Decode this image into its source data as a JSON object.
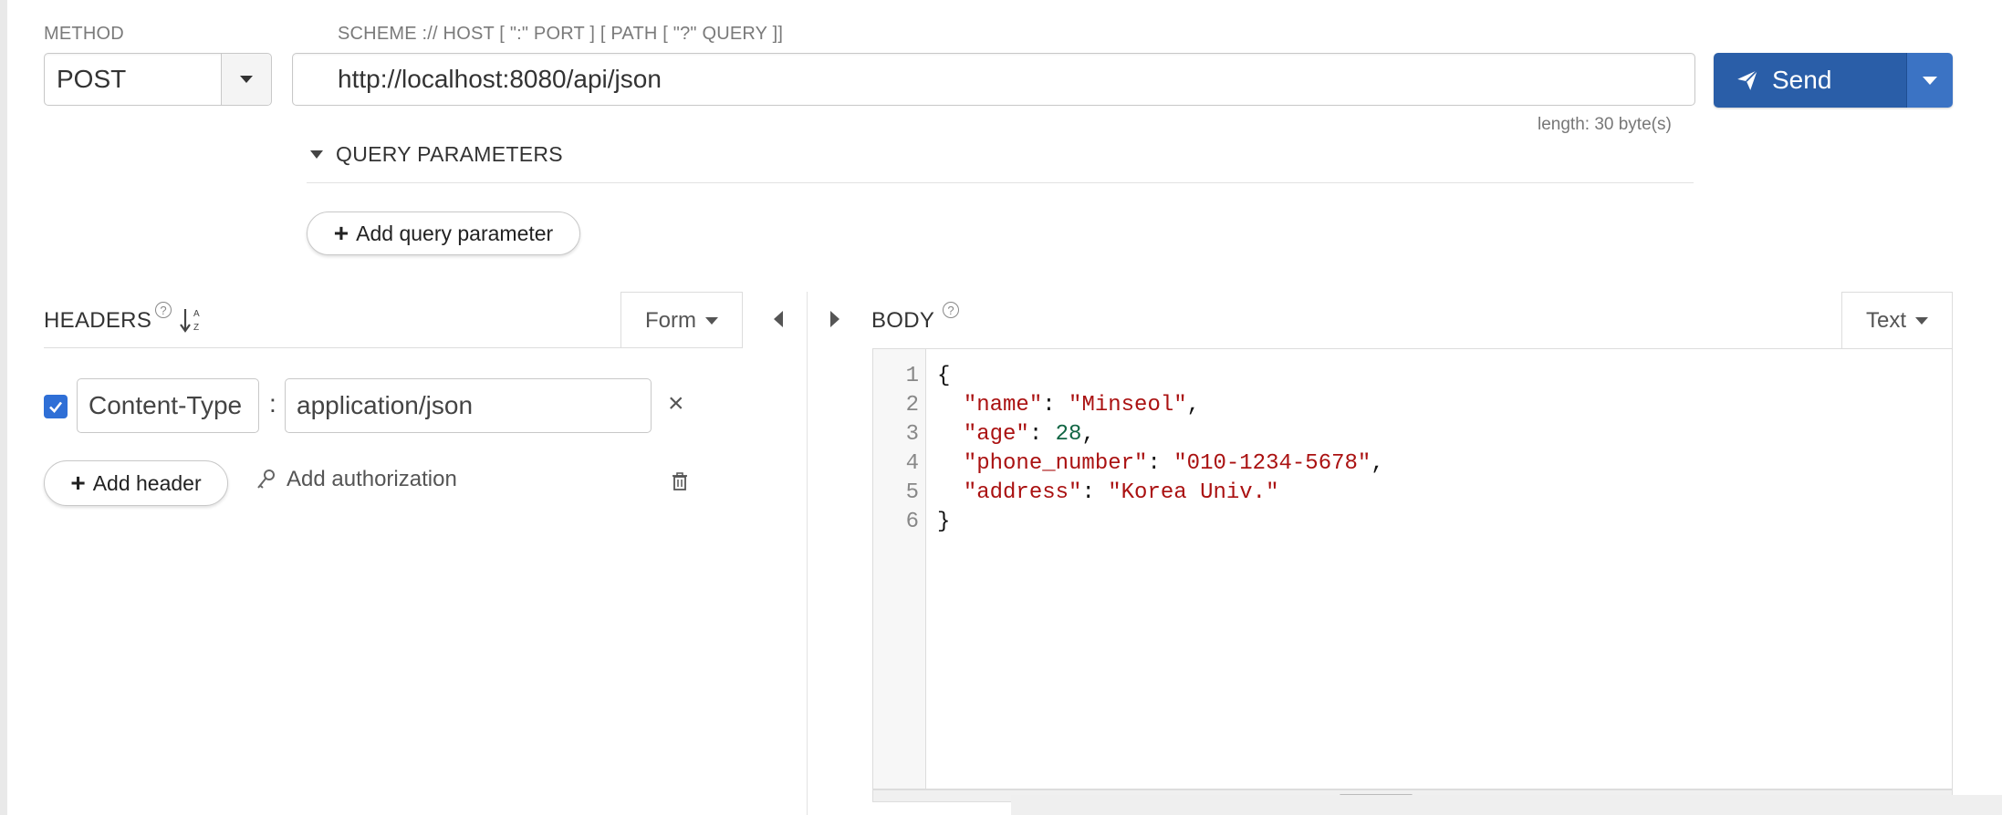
{
  "method": {
    "label": "METHOD",
    "value": "POST"
  },
  "url": {
    "label": "SCHEME :// HOST [ \":\" PORT ] [ PATH [ \"?\" QUERY ]]",
    "value": "http://localhost:8080/api/json",
    "length_text": "length: 30 byte(s)"
  },
  "send": {
    "label": "Send"
  },
  "query_parameters": {
    "title": "QUERY PARAMETERS",
    "add_label": "Add query parameter"
  },
  "headers": {
    "title": "HEADERS",
    "help": "?",
    "mode": "Form",
    "items": [
      {
        "enabled": true,
        "key": "Content-Type",
        "value": "application/json"
      }
    ],
    "separator": ":",
    "add_header_label": "Add header",
    "add_auth_label": "Add authorization"
  },
  "body": {
    "title": "BODY",
    "help": "?",
    "mode": "Text",
    "lines": [
      {
        "n": "1",
        "text": "{"
      },
      {
        "n": "2",
        "key": "\"name\"",
        "value": "\"Minseol\"",
        "type": "string",
        "trail": ","
      },
      {
        "n": "3",
        "key": "\"age\"",
        "value": "28",
        "type": "number",
        "trail": ","
      },
      {
        "n": "4",
        "key": "\"phone_number\"",
        "value": "\"010-1234-5678\"",
        "type": "string",
        "trail": ","
      },
      {
        "n": "5",
        "key": "\"address\"",
        "value": "\"Korea Univ.\"",
        "type": "string",
        "trail": ""
      },
      {
        "n": "6",
        "text": "}"
      }
    ]
  },
  "colors": {
    "accent": "#2a5ea8",
    "checkbox": "#2f6fd6",
    "json_string": "#aa1111",
    "json_number": "#116644"
  }
}
